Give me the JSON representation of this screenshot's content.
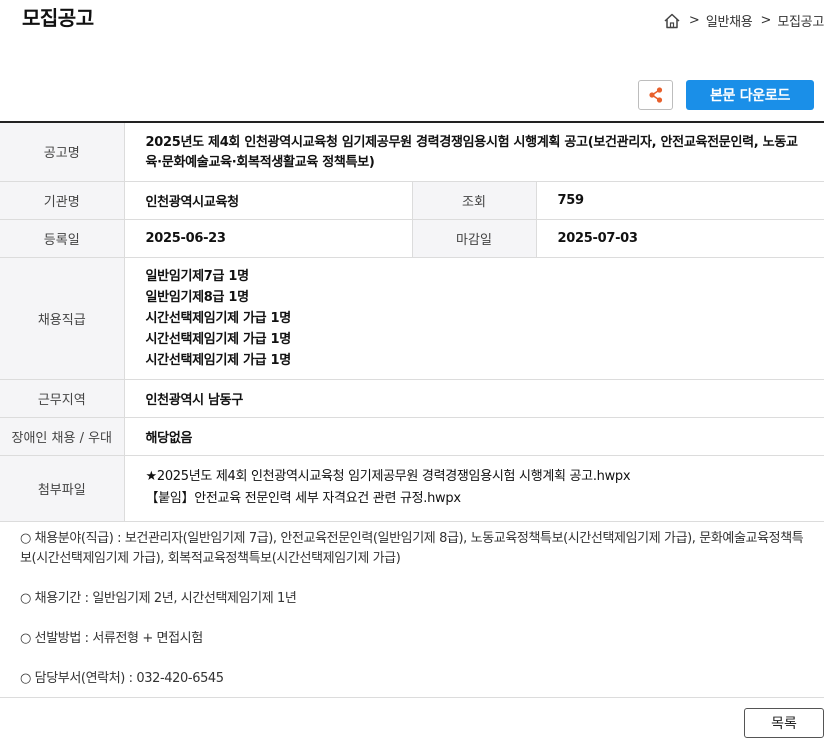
{
  "page": {
    "title": "모집공고"
  },
  "breadcrumb": {
    "items": [
      {
        "label": "일반채용"
      },
      {
        "label": "모집공고"
      }
    ],
    "separator": ">"
  },
  "actions": {
    "share_icon": "share-icon",
    "download_label": "본문 다운로드",
    "list_label": "목록"
  },
  "colors": {
    "accent": "#1a8fe8",
    "share": "#e8602c"
  },
  "info": {
    "title_label": "공고명",
    "title_value": "2025년도 제4회 인천광역시교육청 임기제공무원 경력경쟁임용시험 시행계획 공고(보건관리자, 안전교육전문인력, 노동교육·문화예술교육·회복적생활교육 정책특보)",
    "agency_label": "기관명",
    "agency_value": "인천광역시교육청",
    "views_label": "조회",
    "views_value": "759",
    "regdate_label": "등록일",
    "regdate_value": "2025-06-23",
    "deadline_label": "마감일",
    "deadline_value": "2025-07-03",
    "positions_label": "채용직급",
    "positions": [
      "일반임기제7급 1명",
      "일반임기제8급 1명",
      "시간선택제임기제 가급 1명",
      "시간선택제임기제 가급 1명",
      "시간선택제임기제 가급 1명"
    ],
    "location_label": "근무지역",
    "location_value": "인천광역시 남동구",
    "disability_label": "장애인 채용 / 우대",
    "disability_value": "해당없음",
    "attach_label": "첨부파일",
    "attachments": [
      "★2025년도 제4회 인천광역시교육청 임기제공무원 경력경쟁임용시험 시행계획 공고.hwpx",
      "【붙임】안전교육 전문인력 세부 자격요건 관련 규정.hwpx"
    ]
  },
  "body": {
    "lines": [
      "○ 채용분야(직급) : 보건관리자(일반임기제 7급), 안전교육전문인력(일반임기제 8급), 노동교육정책특보(시간선택제임기제 가급), 문화예술교육정책특보(시간선택제임기제 가급), 회복적교육정책특보(시간선택제임기제 가급)",
      "○ 채용기간 : 일반임기제 2년, 시간선택제임기제 1년",
      "○ 선발방법 : 서류전형 + 면접시험",
      "○ 담당부서(연락처) : 032-420-6545"
    ]
  }
}
